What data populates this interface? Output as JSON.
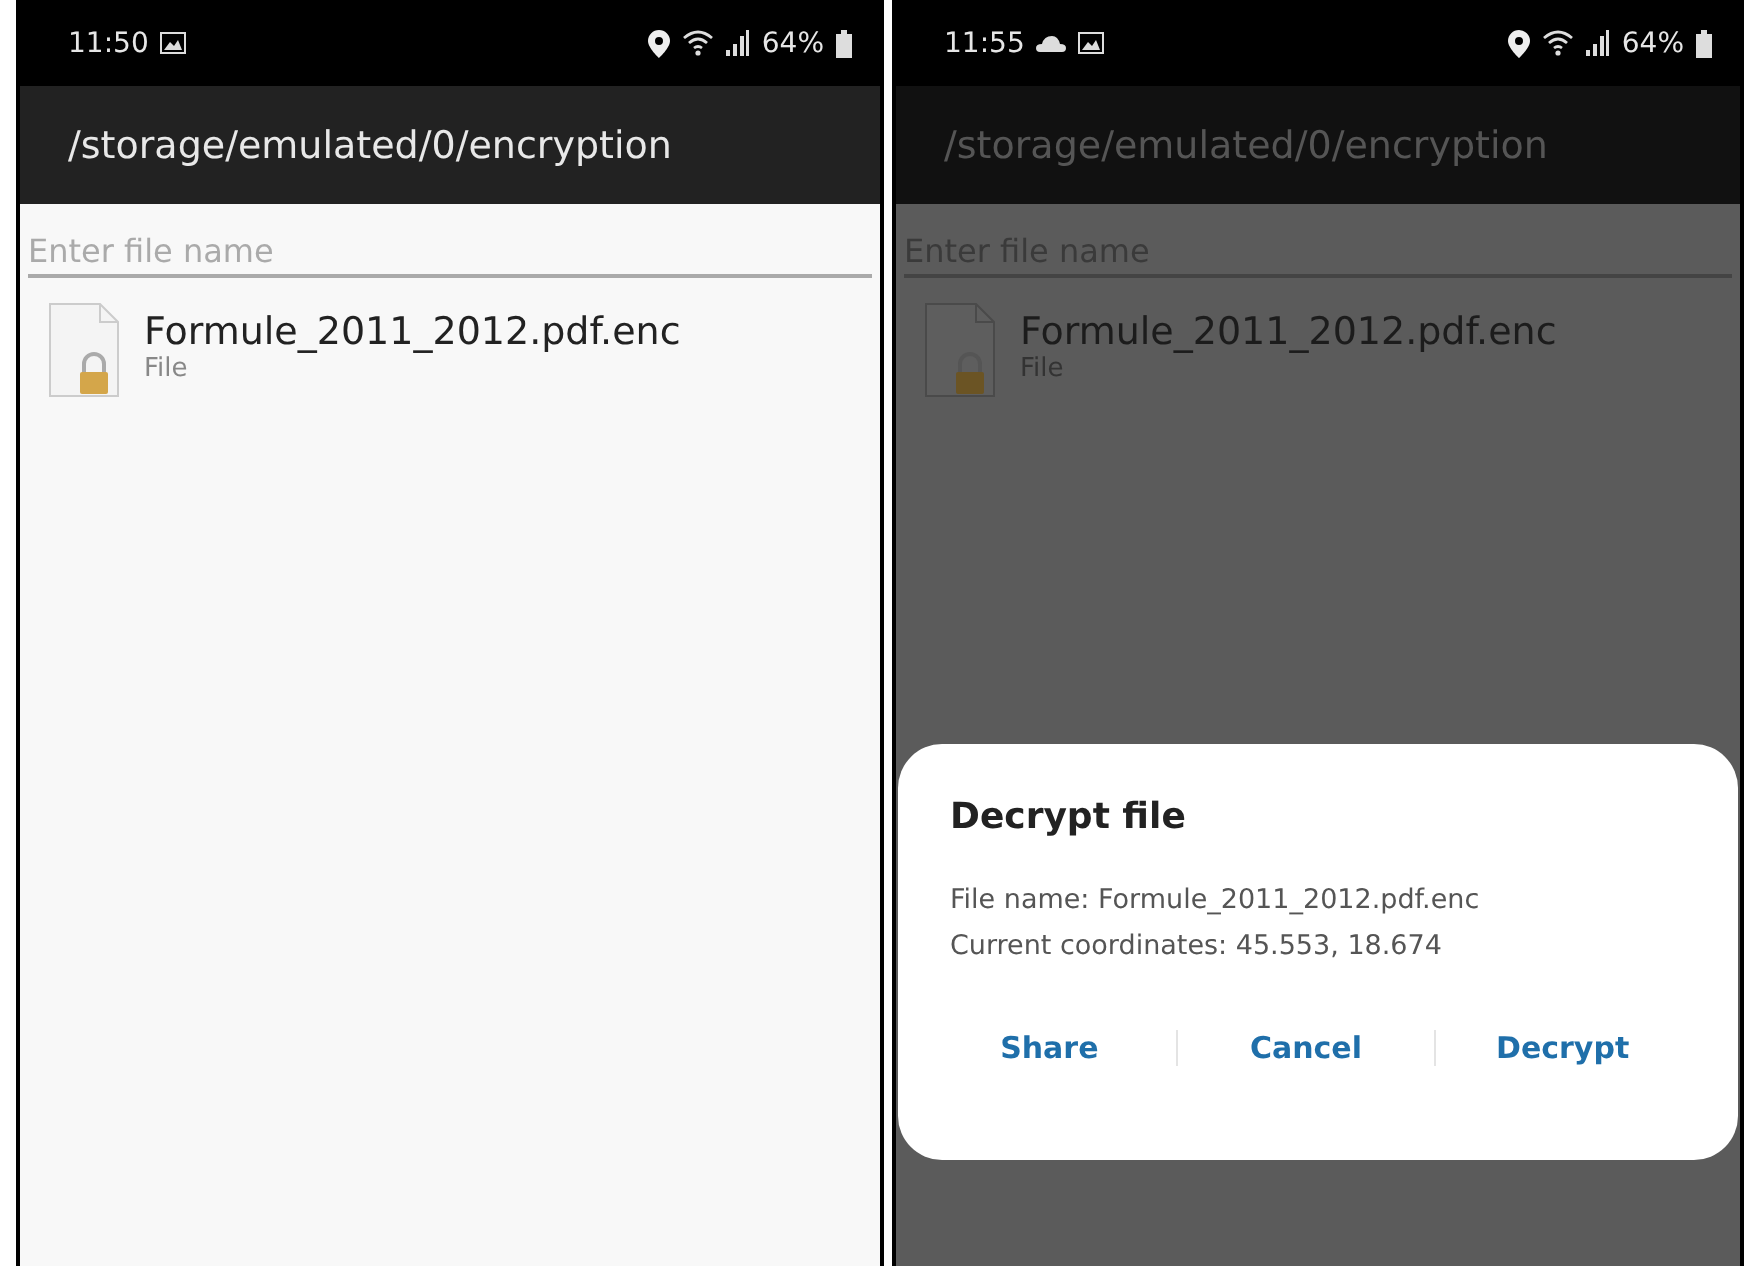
{
  "screens": [
    {
      "status_bar": {
        "time": "11:50",
        "notification_icons": [
          {
            "kind": "image"
          }
        ],
        "battery": "64%"
      },
      "title": "/storage/emulated/0/encryption",
      "search": {
        "placeholder": "Enter file name"
      },
      "files": [
        {
          "name": "Formule_2011_2012.pdf.enc",
          "type": "File"
        }
      ],
      "dimmed": false
    },
    {
      "status_bar": {
        "time": "11:55",
        "notification_icons": [
          {
            "kind": "cloud"
          },
          {
            "kind": "image"
          }
        ],
        "battery": "64%"
      },
      "title": "/storage/emulated/0/encryption",
      "search": {
        "placeholder": "Enter file name"
      },
      "files": [
        {
          "name": "Formule_2011_2012.pdf.enc",
          "type": "File"
        }
      ],
      "dimmed": true,
      "dialog": {
        "title": "Decrypt file",
        "lines": [
          "File name: Formule_2011_2012.pdf.enc",
          "Current coordinates: 45.553, 18.674"
        ],
        "buttons": [
          "Share",
          "Cancel",
          "Decrypt"
        ]
      }
    }
  ]
}
